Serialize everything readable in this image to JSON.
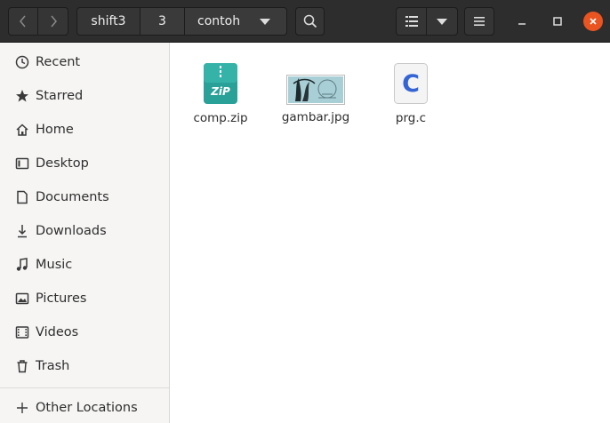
{
  "header": {
    "breadcrumbs": [
      "shift3",
      "3",
      "contoh"
    ]
  },
  "sidebar": {
    "items": [
      {
        "label": "Recent",
        "icon": "clock-icon"
      },
      {
        "label": "Starred",
        "icon": "star-icon"
      },
      {
        "label": "Home",
        "icon": "home-icon"
      },
      {
        "label": "Desktop",
        "icon": "desktop-icon"
      },
      {
        "label": "Documents",
        "icon": "documents-icon"
      },
      {
        "label": "Downloads",
        "icon": "download-icon"
      },
      {
        "label": "Music",
        "icon": "music-icon"
      },
      {
        "label": "Pictures",
        "icon": "pictures-icon"
      },
      {
        "label": "Videos",
        "icon": "videos-icon"
      },
      {
        "label": "Trash",
        "icon": "trash-icon"
      }
    ],
    "other_locations": "Other Locations"
  },
  "files": [
    {
      "name": "comp.zip",
      "icon": "zip-file-icon",
      "icon_text": "ZiP"
    },
    {
      "name": "gambar.jpg",
      "icon": "image-thumbnail-icon"
    },
    {
      "name": "prg.c",
      "icon": "c-source-file-icon",
      "icon_text": "C"
    }
  ],
  "colors": {
    "headerbar": "#2d2d2d",
    "close_button": "#e95420",
    "zip_icon": "#2aa198",
    "c_icon_letter": "#3465d4"
  }
}
